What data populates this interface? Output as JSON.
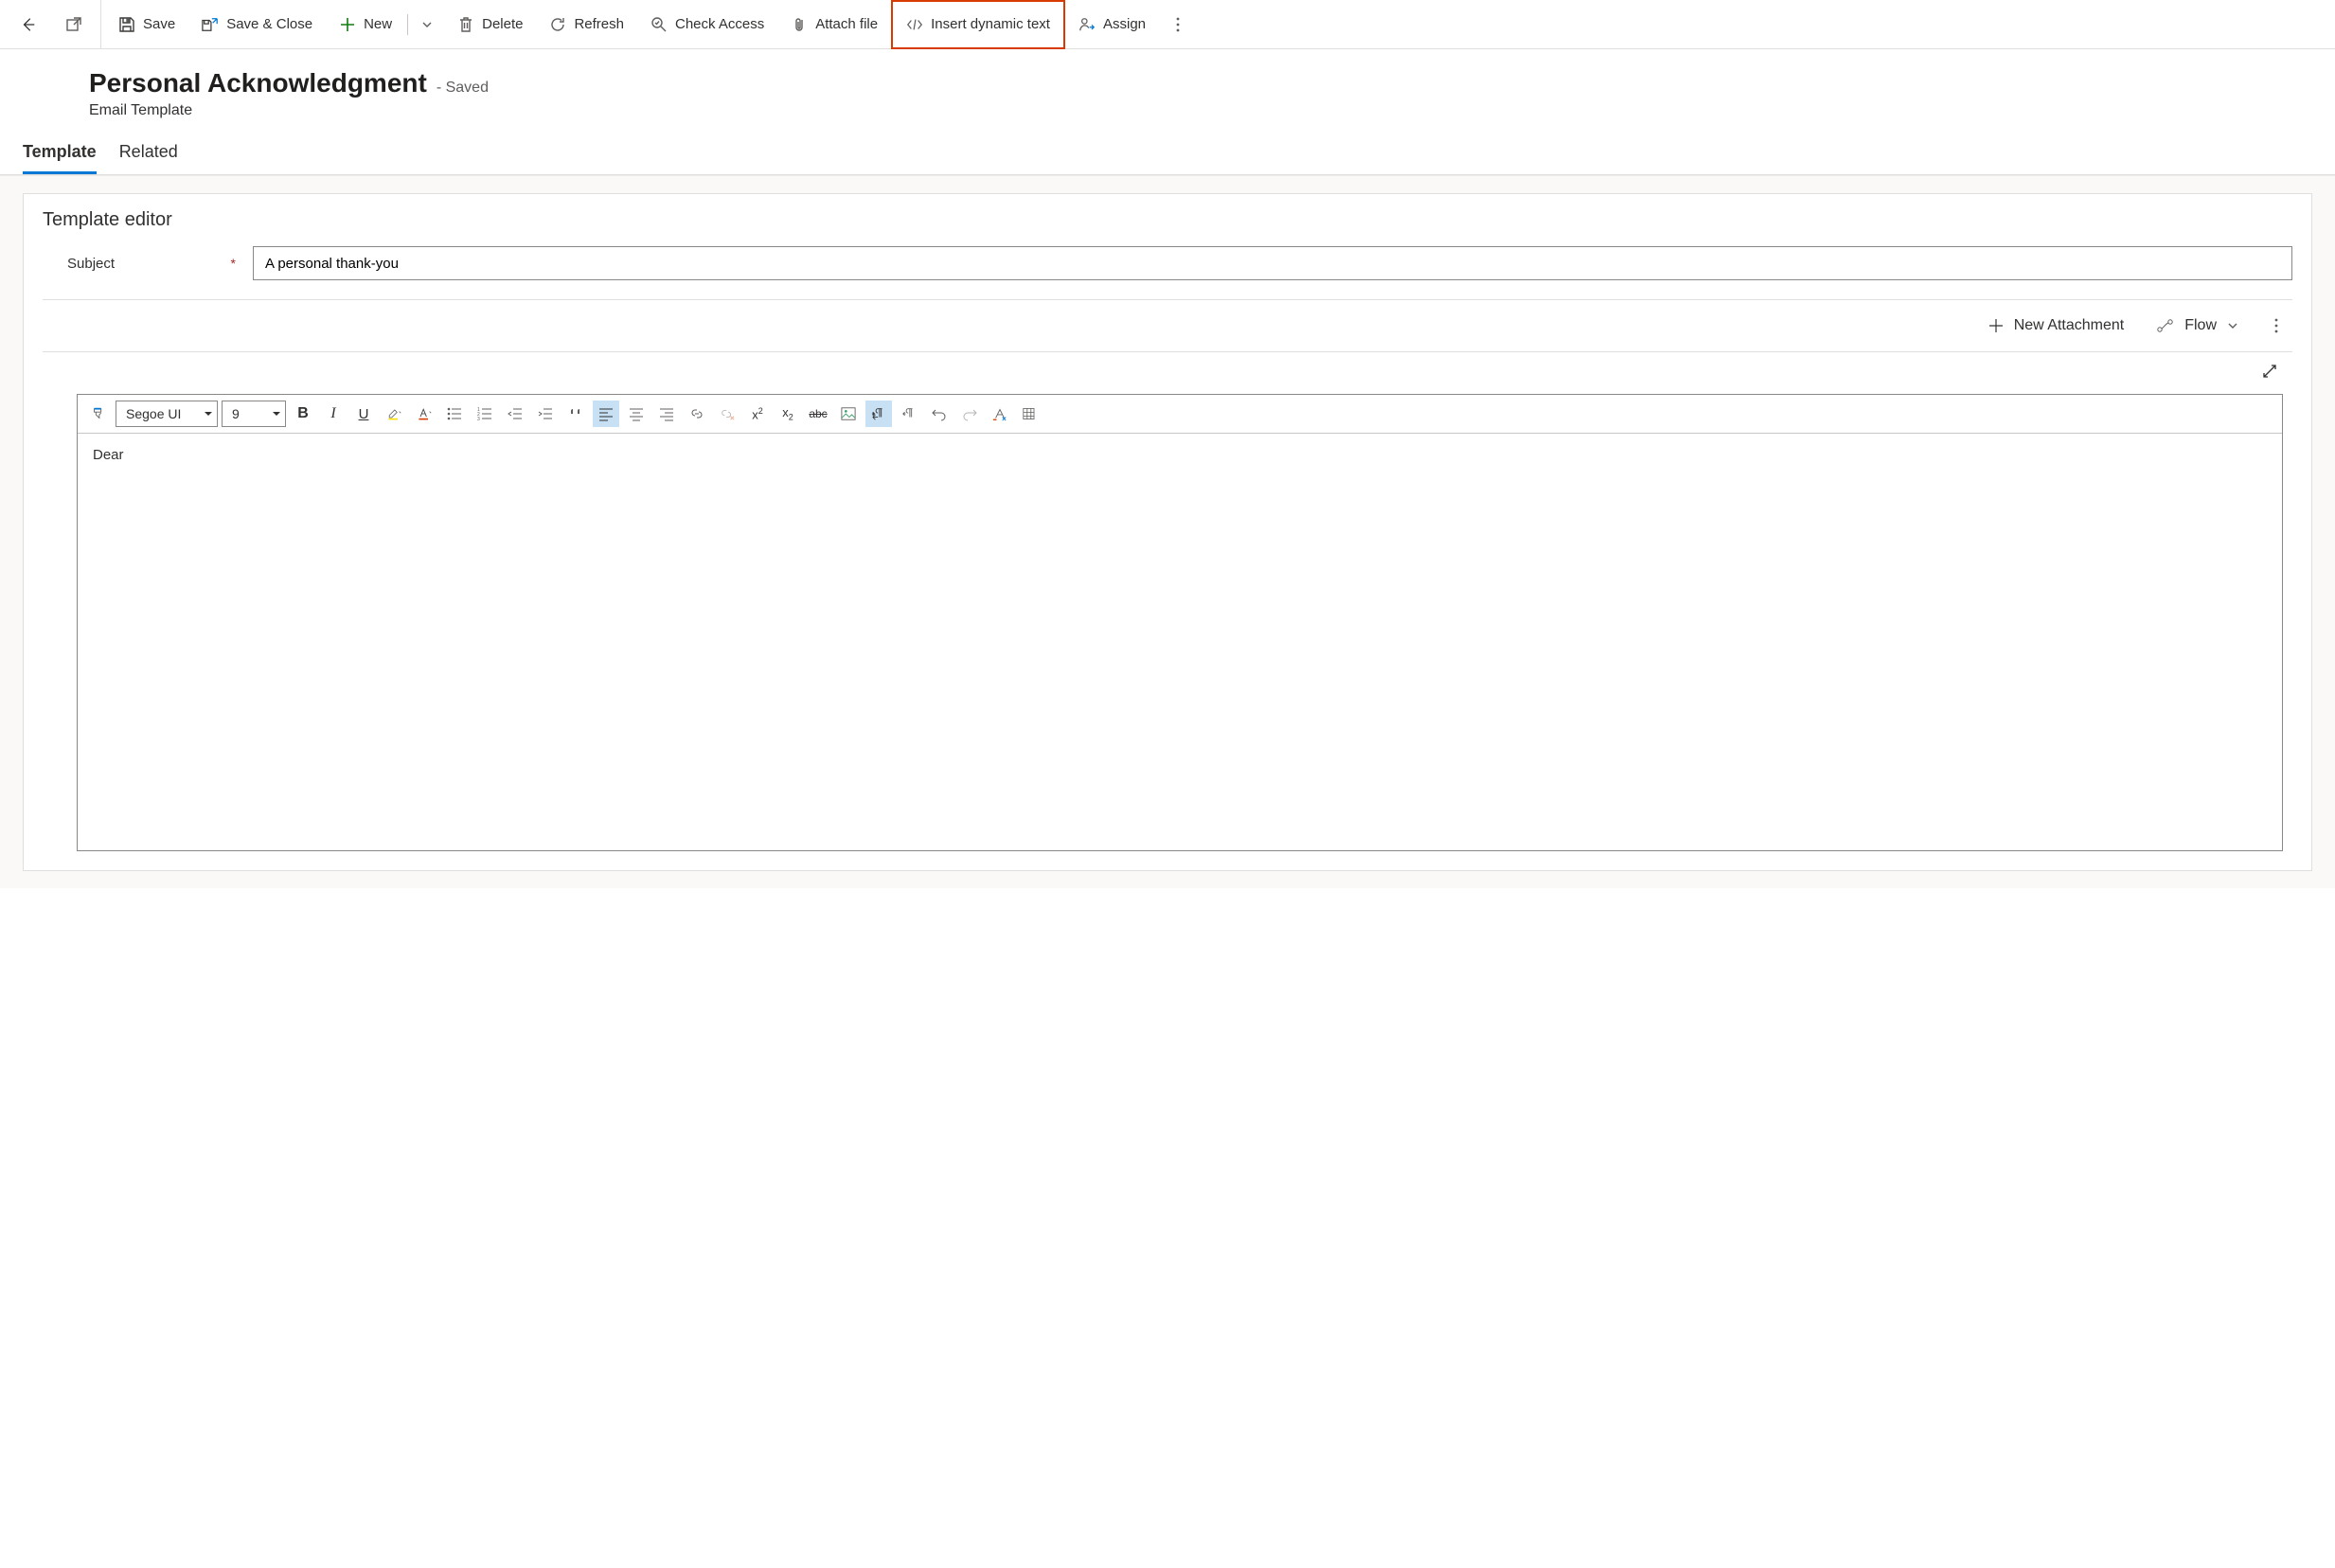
{
  "toolbar": {
    "save": "Save",
    "save_close": "Save & Close",
    "new": "New",
    "delete": "Delete",
    "refresh": "Refresh",
    "check_access": "Check Access",
    "attach_file": "Attach file",
    "insert_dynamic": "Insert dynamic text",
    "assign": "Assign"
  },
  "header": {
    "title": "Personal Acknowledgment",
    "status": "- Saved",
    "entity": "Email Template"
  },
  "tabs": {
    "template": "Template",
    "related": "Related"
  },
  "editor": {
    "section_title": "Template editor",
    "subject_label": "Subject",
    "subject_value": "A personal thank-you",
    "new_attachment": "New Attachment",
    "flow": "Flow",
    "font_name": "Segoe UI",
    "font_size": "9",
    "body_text": "Dear"
  }
}
